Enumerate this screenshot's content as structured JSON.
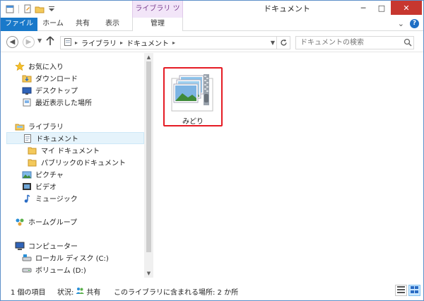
{
  "window": {
    "title": "ドキュメント",
    "context_tab_group": "ライブラリ ツール",
    "minimize": "─",
    "maximize": "□",
    "close": "✕"
  },
  "ribbon": {
    "tabs": [
      {
        "label": "ファイル"
      },
      {
        "label": "ホーム"
      },
      {
        "label": "共有"
      },
      {
        "label": "表示"
      },
      {
        "label": "管理"
      }
    ],
    "collapse": "⌄",
    "help": "?"
  },
  "address": {
    "crumbs": [
      "ライブラリ",
      "ドキュメント"
    ],
    "search_placeholder": "ドキュメントの検索"
  },
  "nav": {
    "favorites": "お気に入り",
    "favorites_items": [
      "ダウンロード",
      "デスクトップ",
      "最近表示した場所"
    ],
    "libraries": "ライブラリ",
    "library_items": [
      "ドキュメント",
      "マイ ドキュメント",
      "パブリックのドキュメント",
      "ピクチャ",
      "ビデオ",
      "ミュージック"
    ],
    "homegroup": "ホームグループ",
    "computer": "コンピューター",
    "computer_items": [
      "ローカル ディスク (C:)",
      "ボリューム (D:)"
    ]
  },
  "content": {
    "files": [
      {
        "name": "みどり",
        "type": "zip-folder"
      }
    ]
  },
  "status": {
    "item_count": "1 個の項目",
    "state_label": "状況:",
    "state_value": "共有",
    "location": "このライブラリに含まれる場所: 2 か所"
  },
  "colors": {
    "file_tab": "#1979ca",
    "context_tab_bg": "#f2e5f8",
    "close_button": "#c7372f",
    "highlight_border": "#e51b24",
    "selection_bg": "#e5f3fb"
  }
}
